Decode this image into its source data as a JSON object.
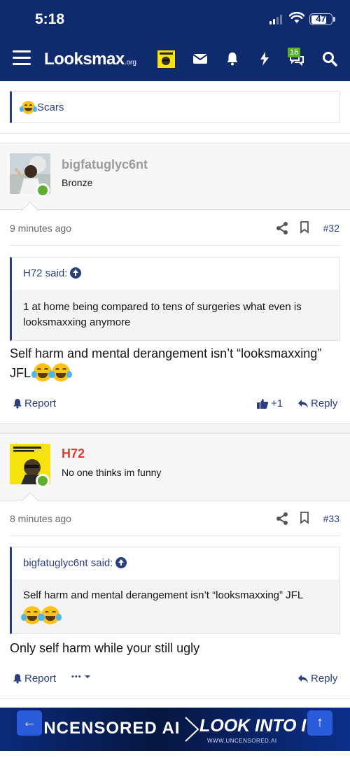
{
  "status_bar": {
    "time": "5:18",
    "battery": "47"
  },
  "nav": {
    "logo_main": "Looksmax",
    "logo_tld": ".org",
    "alerts_badge": "16"
  },
  "top_quote": {
    "text": "Scars"
  },
  "posts": [
    {
      "username": "bigfatuglyc6nt",
      "username_color": "#9a9a9a",
      "user_title": "Bronze",
      "time": "9 minutes ago",
      "number": "#32",
      "quote_author": "H72 said:",
      "quote_text": "1 at home being compared to tens of surgeries what even is looksmaxxing anymore",
      "body_line1": "Self harm and mental derangement isn’t “looksmaxxing”",
      "body_line2": "JFL",
      "report": "Report",
      "likes": "+1",
      "reply": "Reply"
    },
    {
      "username": "H72",
      "username_color": "#e03a2f",
      "user_title": "No one thinks im funny",
      "time": "8 minutes ago",
      "number": "#33",
      "quote_author": "bigfatuglyc6nt said:",
      "quote_text": "Self harm and mental derangement isn’t “looksmaxxing” JFL",
      "body_line1": "Only self harm while your still ugly",
      "report": "Report",
      "more": "•••",
      "reply": "Reply"
    }
  ],
  "ad": {
    "left_text": "UNCENSORED AI",
    "right_text": "LOOK INTO IT",
    "sub_text": "WWW.UNCENSORED.AI",
    "back_arrow": "←",
    "up_arrow": "↑"
  },
  "colors": {
    "header": "#0f2b6e",
    "link": "#2c3f7d",
    "online": "#5cae2e"
  }
}
